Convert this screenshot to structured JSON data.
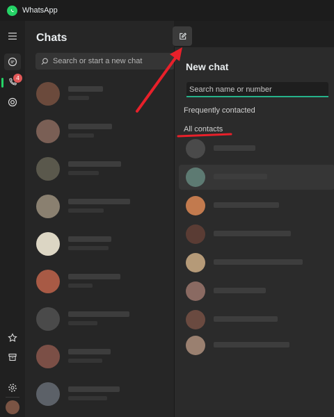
{
  "app": {
    "title": "WhatsApp",
    "accent": "#25d366"
  },
  "rail": {
    "icons": [
      "menu-icon",
      "chats-icon",
      "calls-icon",
      "status-icon",
      "starred-icon",
      "archive-icon",
      "settings-icon",
      "profile-avatar"
    ],
    "calls_badge": "4"
  },
  "chats": {
    "title": "Chats",
    "search_placeholder": "Search or start a new chat",
    "rows": [
      {
        "avatar_color": "#6b4a3c"
      },
      {
        "avatar_color": "#7a5f55"
      },
      {
        "avatar_color": "#5a584c"
      },
      {
        "avatar_color": "#8a8070"
      },
      {
        "avatar_color": "#dcd6c4"
      },
      {
        "avatar_color": "#a85a45"
      },
      {
        "avatar_color": "#4a4a4a"
      },
      {
        "avatar_color": "#7b4f46"
      },
      {
        "avatar_color": "#5c6168"
      }
    ]
  },
  "new_chat": {
    "title": "New chat",
    "search_placeholder": "Search name or number",
    "frequently_contacted": "Frequently contacted",
    "all_contacts": "All contacts",
    "contacts": [
      {
        "avatar_color": "#4a4a4a"
      },
      {
        "avatar_color": "#5d7a72"
      },
      {
        "avatar_color": "#c27a4e"
      },
      {
        "avatar_color": "#5a3c34"
      },
      {
        "avatar_color": "#b59a78"
      },
      {
        "avatar_color": "#8a6a62"
      },
      {
        "avatar_color": "#6a4a40"
      },
      {
        "avatar_color": "#9a8070"
      }
    ]
  },
  "annotation_color": "#e8202a"
}
